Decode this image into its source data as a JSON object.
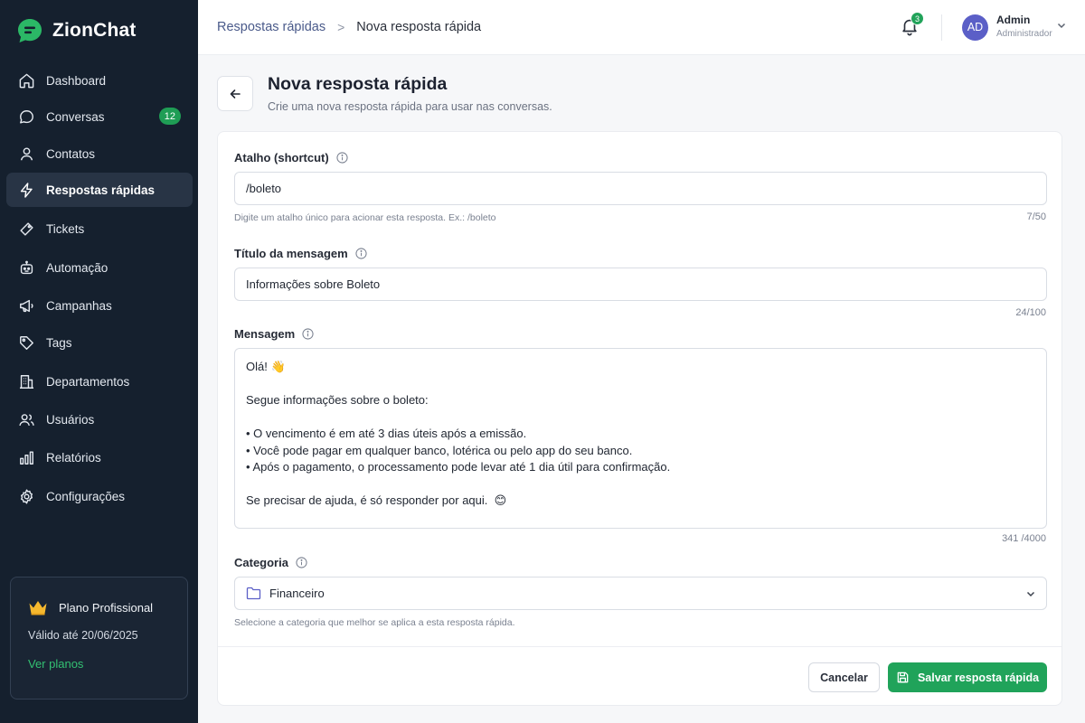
{
  "brand": {
    "name": "ZionChat"
  },
  "sidebar": {
    "items": [
      {
        "label": "Dashboard",
        "icon": "home-icon"
      },
      {
        "label": "Conversas",
        "icon": "chat-icon",
        "badge": "12"
      },
      {
        "label": "Contatos",
        "icon": "user-icon"
      },
      {
        "label": "Respostas rápidas",
        "icon": "lightning-icon",
        "active": true
      },
      {
        "label": "Tickets",
        "icon": "ticket-icon"
      },
      {
        "label": "Automação",
        "icon": "robot-icon"
      },
      {
        "label": "Campanhas",
        "icon": "megaphone-icon"
      },
      {
        "label": "Tags",
        "icon": "tag-icon"
      },
      {
        "label": "Departamentos",
        "icon": "building-icon"
      },
      {
        "label": "Usuários",
        "icon": "users-icon"
      },
      {
        "label": "Relatórios",
        "icon": "bar-chart-icon"
      },
      {
        "label": "Configurações",
        "icon": "gear-icon"
      }
    ],
    "plan": {
      "title": "Plano Profissional",
      "valid_until": "Válido até 20/06/2025",
      "link": "Ver planos"
    }
  },
  "header": {
    "breadcrumb": {
      "parent": "Respostas rápidas",
      "separator": ">",
      "current": "Nova resposta rápida"
    },
    "notifications_count": "3",
    "user": {
      "initials": "AD",
      "name": "Admin",
      "role": "Administrador"
    }
  },
  "page": {
    "title": "Nova resposta rápida",
    "subtitle": "Crie uma nova resposta rápida para usar nas conversas."
  },
  "form": {
    "shortcut": {
      "label": "Atalho (shortcut)",
      "value": "/boleto",
      "hint": "Digite um atalho único para acionar esta resposta. Ex.: /boleto",
      "counter": "7/50"
    },
    "title": {
      "label": "Título da mensagem",
      "value": "Informações sobre Boleto",
      "counter": "24/100"
    },
    "message": {
      "label": "Mensagem",
      "lines": [
        "Olá! 👋",
        "",
        "Segue informações sobre o boleto:",
        "",
        "• O vencimento é em até 3 dias úteis após a emissão.",
        "• Você pode pagar em qualquer banco, lotérica ou pelo app do seu banco.",
        "• Após o pagamento, o processamento pode levar até 1 dia útil para confirmação.",
        "",
        "Se precisar de ajuda, é só responder por aqui.  😊"
      ],
      "counter": "341 /4000"
    },
    "category": {
      "label": "Categoria",
      "value": "Financeiro",
      "hint": "Selecione a categoria que melhor se aplica a esta resposta rápida."
    }
  },
  "actions": {
    "cancel": "Cancelar",
    "save": "Salvar resposta rápida"
  },
  "colors": {
    "sidebar_bg": "#15202e",
    "accent_green": "#20a35a",
    "avatar": "#5b5fc7"
  }
}
